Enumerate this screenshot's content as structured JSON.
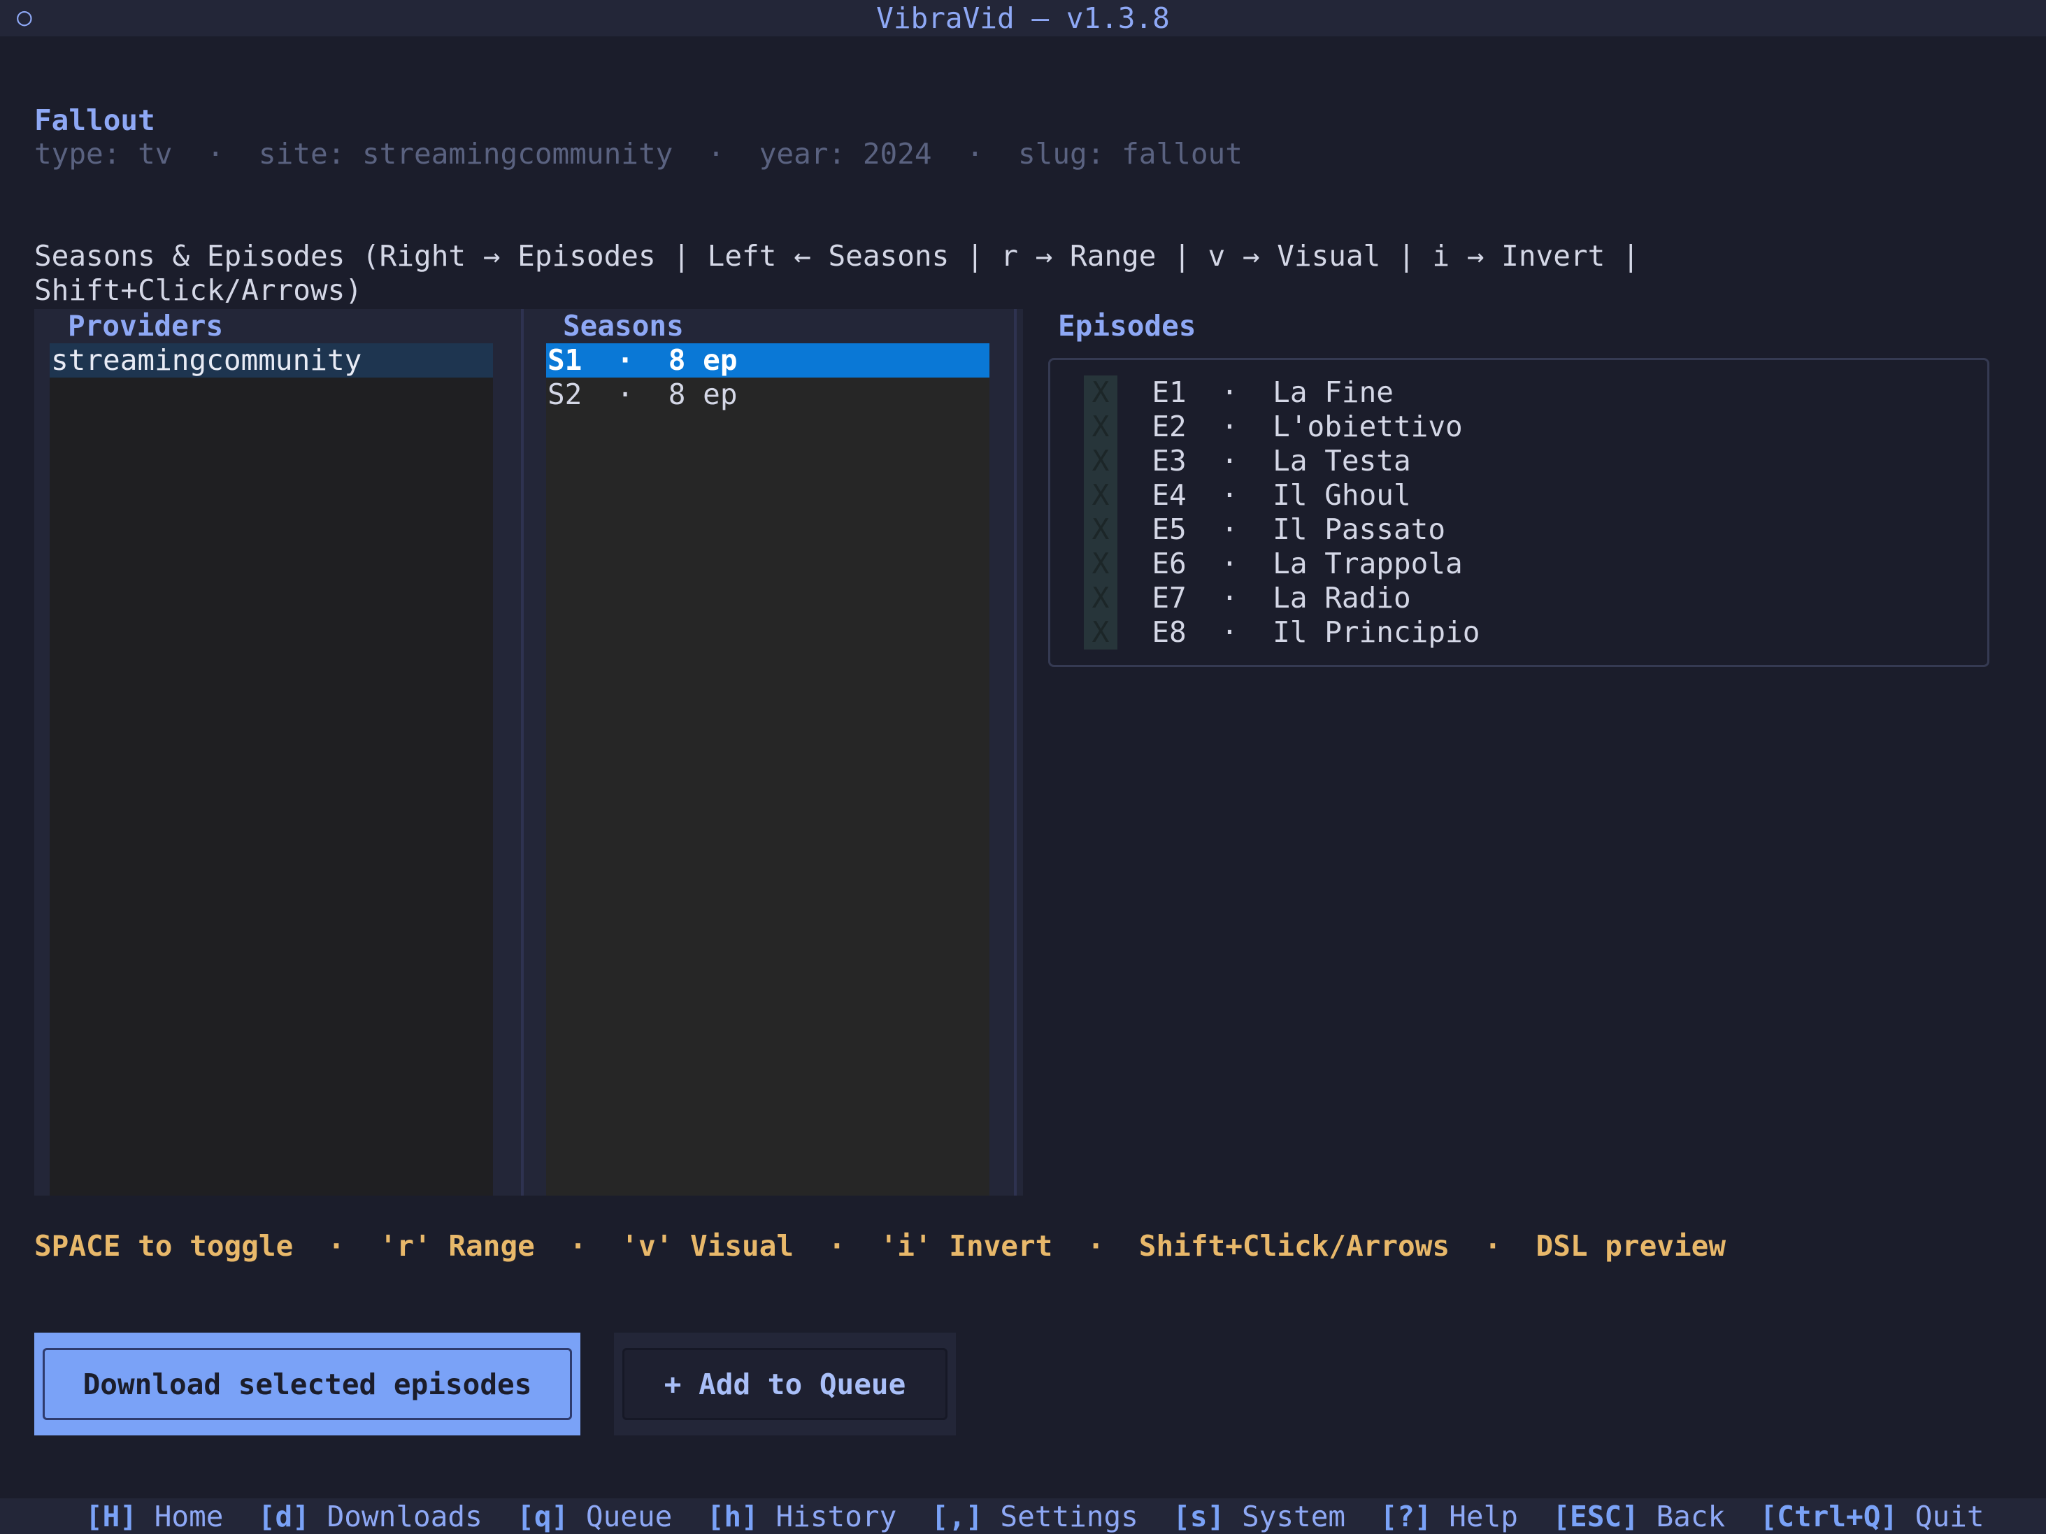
{
  "window": {
    "title": "VibraVid — v1.3.8",
    "indicator": "○"
  },
  "show": {
    "title": "Fallout",
    "meta": "type: tv  ·  site: streamingcommunity  ·  year: 2024  ·  slug: fallout"
  },
  "instructions": {
    "line1": "Seasons & Episodes (Right → Episodes | Left ← Seasons | r → Range | v → Visual | i → Invert |",
    "line2": "Shift+Click/Arrows)"
  },
  "providers": {
    "title": "Providers",
    "items": [
      "streamingcommunity"
    ]
  },
  "seasons": {
    "title": "Seasons",
    "items": [
      {
        "label": "S1  ·  8 ep",
        "selected": true
      },
      {
        "label": "S2  ·  8 ep",
        "selected": false
      }
    ]
  },
  "episodes": {
    "title": "Episodes",
    "items": [
      {
        "check": "X",
        "label": "E1  ·  La Fine"
      },
      {
        "check": "X",
        "label": "E2  ·  L'obiettivo"
      },
      {
        "check": "X",
        "label": "E3  ·  La Testa"
      },
      {
        "check": "X",
        "label": "E4  ·  Il Ghoul"
      },
      {
        "check": "X",
        "label": "E5  ·  Il Passato"
      },
      {
        "check": "X",
        "label": "E6  ·  La Trappola"
      },
      {
        "check": "X",
        "label": "E7  ·  La Radio"
      },
      {
        "check": "X",
        "label": "E8  ·  Il Principio"
      }
    ]
  },
  "hints": "SPACE to toggle  ·  'r' Range  ·  'v' Visual  ·  'i' Invert  ·  Shift+Click/Arrows  ·  DSL preview",
  "actions": {
    "download_label": "Download selected episodes",
    "queue_label": "+ Add to Queue"
  },
  "footer": [
    {
      "key": "[H]",
      "label": "Home"
    },
    {
      "key": "[d]",
      "label": "Downloads"
    },
    {
      "key": "[q]",
      "label": "Queue"
    },
    {
      "key": "[h]",
      "label": "History"
    },
    {
      "key": "[,]",
      "label": "Settings"
    },
    {
      "key": "[s]",
      "label": "System"
    },
    {
      "key": "[?]",
      "label": "Help"
    },
    {
      "key": "[ESC]",
      "label": "Back"
    },
    {
      "key": "[Ctrl+Q]",
      "label": "Quit"
    }
  ],
  "colors": {
    "background": "#1b1d2b",
    "accent": "#7aa2f7",
    "selection": "#0a78d6",
    "hint": "#e8b86a"
  }
}
